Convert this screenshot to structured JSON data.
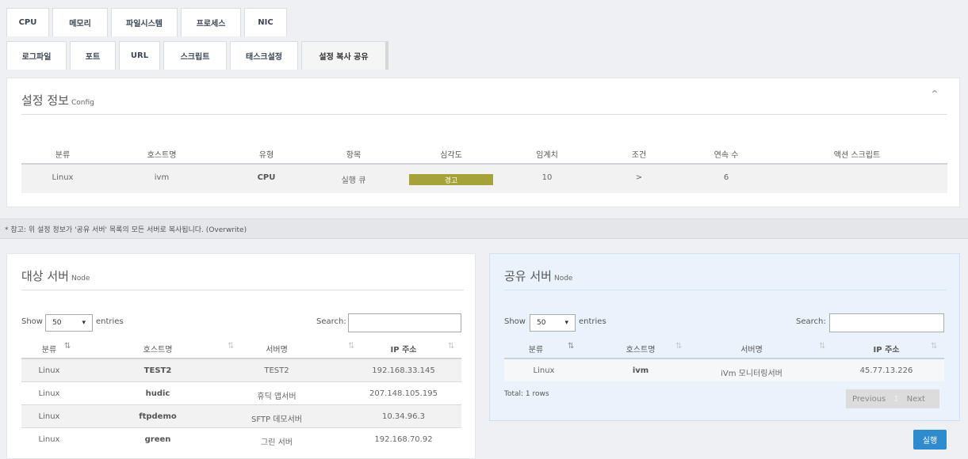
{
  "tabs_row1": [
    "CPU",
    "메모리",
    "파일시스템",
    "프로세스",
    "NIC"
  ],
  "tabs_row2": [
    "로그파일",
    "포트",
    "URL",
    "스크립트",
    "태스크설정",
    "설정 복사 공유"
  ],
  "config": {
    "title": "설정 정보",
    "subtitle": "Config",
    "headers": [
      "분류",
      "호스트명",
      "유형",
      "항목",
      "심각도",
      "임계치",
      "조건",
      "연속 수",
      "액션 스크립트"
    ],
    "row": [
      "Linux",
      "ivm",
      "CPU",
      "실행 큐",
      "경고",
      "10",
      ">",
      "6",
      ""
    ],
    "severity_color": "#a5a23a"
  },
  "note": "* 참고: 위 설정 정보가 '공유 서버' 목록의 모든 서버로 복사됩니다. (Overwrite)",
  "target": {
    "title": "대상 서버",
    "subtitle": "Node",
    "show_label": "Show",
    "entries_label": "entries",
    "page_size": "50",
    "search_label": "Search:",
    "headers": [
      "분류",
      "호스트명",
      "서버명",
      "IP 주소"
    ],
    "rows": [
      [
        "Linux",
        "TEST2",
        "TEST2",
        "192.168.33.145"
      ],
      [
        "Linux",
        "hudic",
        "휴딕 앱서버",
        "207.148.105.195"
      ],
      [
        "Linux",
        "ftpdemo",
        "SFTP 데모서버",
        "10.34.96.3"
      ],
      [
        "Linux",
        "green",
        "그린 서버",
        "192.168.70.92"
      ]
    ]
  },
  "shared": {
    "title": "공유 서버",
    "subtitle": "Node",
    "show_label": "Show",
    "entries_label": "entries",
    "page_size": "50",
    "search_label": "Search:",
    "headers": [
      "분류",
      "호스트명",
      "서버명",
      "IP 주소"
    ],
    "rows": [
      [
        "Linux",
        "ivm",
        "iVm 모니터링서버",
        "45.77.13.226"
      ]
    ],
    "total": "Total: 1 rows",
    "prev": "Previous",
    "page": "1",
    "next": "Next"
  },
  "run_button": "실행",
  "accent": "#2e8bcd"
}
